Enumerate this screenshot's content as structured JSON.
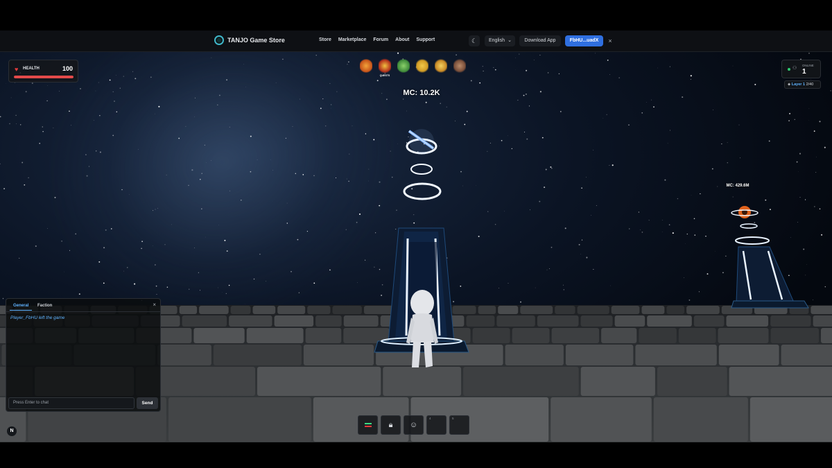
{
  "navbar": {
    "brand": "TANJO Game Store",
    "links": [
      "Store",
      "Marketplace",
      "Forum",
      "About",
      "Support"
    ],
    "language": "English",
    "download_label": "Download App",
    "wallet_label": "FbHU...uadX",
    "close_symbol": "×",
    "theme_icon": "moon-icon"
  },
  "health": {
    "label": "HEALTH",
    "value": "100",
    "fraction": 1.0,
    "icon": "heart-icon",
    "color": "#e34a4a"
  },
  "top_items": [
    {
      "name": "item-1",
      "caption": "",
      "color": "#c7541a"
    },
    {
      "name": "item-quests",
      "caption": "QUESTS",
      "color": "#b4321c"
    },
    {
      "name": "item-3",
      "caption": "",
      "color": "#3f8a3a"
    },
    {
      "name": "item-4",
      "caption": "",
      "color": "#d19b25"
    },
    {
      "name": "item-5",
      "caption": "",
      "color": "#c98a26"
    },
    {
      "name": "item-6",
      "caption": "",
      "color": "#7a4f3a"
    }
  ],
  "market_caps": {
    "main": "MC: 10.2K",
    "side": "MC: 429.6M"
  },
  "online": {
    "label": "ONLINE",
    "count": "1",
    "status_color": "#2ecc71"
  },
  "layer": {
    "label": "Layer 1",
    "progress": "2/40"
  },
  "chat": {
    "tabs": [
      "General",
      "Faction"
    ],
    "active_tab": "General",
    "close_symbol": "×",
    "messages": [
      "Player_FbHU left the game"
    ],
    "input_placeholder": "Press Enter to chat",
    "send_label": "Send"
  },
  "hotbar": {
    "slots": [
      {
        "number": "",
        "icon": "glowstick-icon"
      },
      {
        "number": "",
        "icon": "lock-icon"
      },
      {
        "number": "",
        "icon": "emote-smiley-icon"
      },
      {
        "number": "4",
        "icon": ""
      },
      {
        "number": "5",
        "icon": ""
      }
    ]
  },
  "corner_badge": "N"
}
